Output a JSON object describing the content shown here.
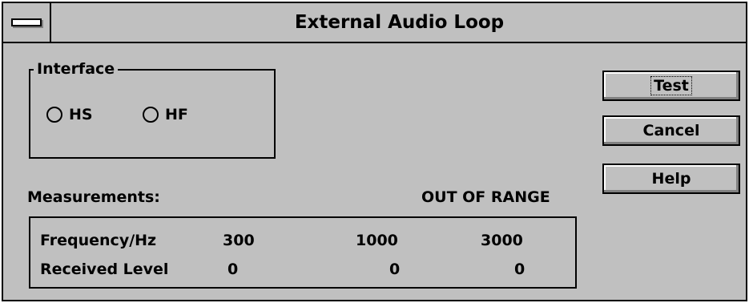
{
  "window": {
    "title": "External Audio Loop"
  },
  "interface": {
    "legend": "Interface",
    "options": [
      {
        "label": "HS",
        "selected": false
      },
      {
        "label": "HF",
        "selected": false
      }
    ]
  },
  "measurements": {
    "label": "Measurements:",
    "status": "OUT OF RANGE",
    "rows": [
      {
        "header": "Frequency/Hz",
        "values": [
          "300",
          "1000",
          "3000"
        ]
      },
      {
        "header": "Received Level",
        "values": [
          "0",
          "0",
          "0"
        ]
      }
    ]
  },
  "buttons": {
    "test": "Test",
    "cancel": "Cancel",
    "help": "Help"
  }
}
